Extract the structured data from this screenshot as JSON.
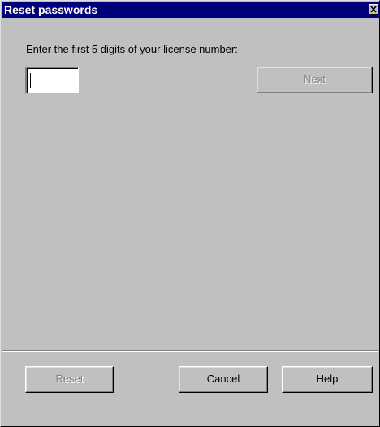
{
  "window": {
    "title": "Reset passwords"
  },
  "form": {
    "prompt": "Enter the first 5 digits of your license number:",
    "license_input_value": ""
  },
  "buttons": {
    "next_label": "Next",
    "reset_label": "Reset",
    "cancel_label": "Cancel",
    "help_label": "Help"
  },
  "icons": {
    "close": "close-icon"
  },
  "colors": {
    "titlebar": "#00007b",
    "face": "#c0c0c0"
  }
}
